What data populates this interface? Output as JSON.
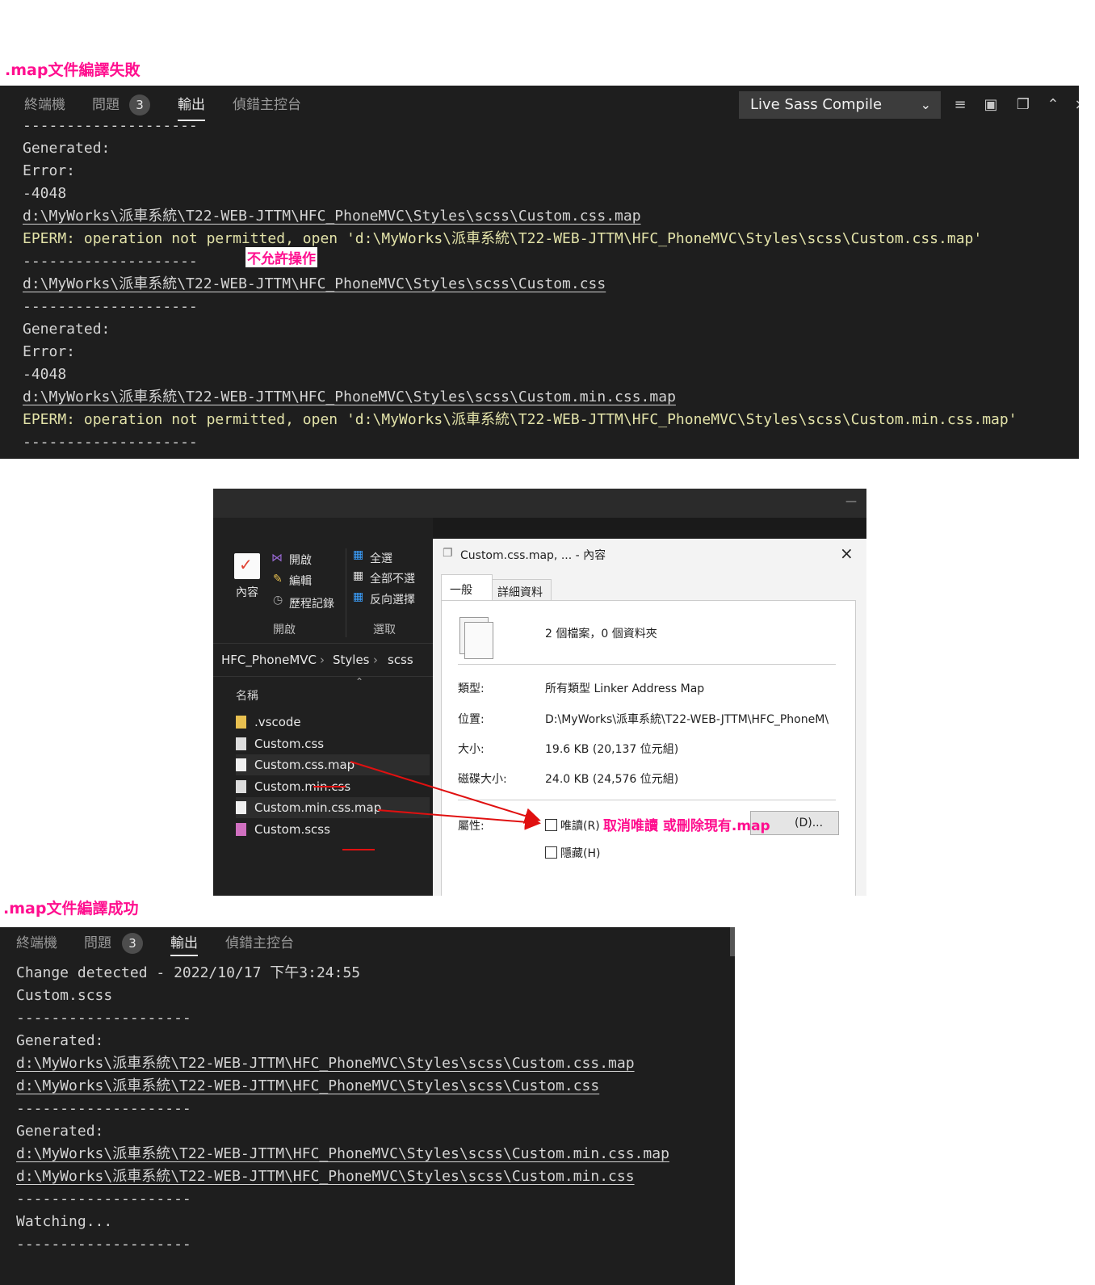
{
  "captions": {
    "fail": ".map文件編譯失敗",
    "success": ".map文件編譯成功"
  },
  "tabs": {
    "terminal": "終端機",
    "problems": "問題",
    "problems_count": "3",
    "output": "輸出",
    "debug": "偵錯主控台"
  },
  "output_channel": "Live Sass Compile",
  "fail_log": [
    {
      "t": "--------------------",
      "cls": ""
    },
    {
      "t": "Generated:",
      "cls": ""
    },
    {
      "t": "Error:",
      "cls": ""
    },
    {
      "t": "-4048",
      "cls": ""
    },
    {
      "t": "d:\\MyWorks\\派車系統\\T22-WEB-JTTM\\HFC_PhoneMVC\\Styles\\scss\\Custom.css.map",
      "cls": "u"
    },
    {
      "t": "EPERM: operation not permitted, open 'd:\\MyWorks\\派車系統\\T22-WEB-JTTM\\HFC_PhoneMVC\\Styles\\scss\\Custom.css.map'",
      "cls": "err"
    },
    {
      "t": "--------------------",
      "cls": ""
    },
    {
      "t": "d:\\MyWorks\\派車系統\\T22-WEB-JTTM\\HFC_PhoneMVC\\Styles\\scss\\Custom.css",
      "cls": "u"
    },
    {
      "t": "--------------------",
      "cls": ""
    },
    {
      "t": "Generated:",
      "cls": ""
    },
    {
      "t": "Error:",
      "cls": ""
    },
    {
      "t": "-4048",
      "cls": ""
    },
    {
      "t": "d:\\MyWorks\\派車系統\\T22-WEB-JTTM\\HFC_PhoneMVC\\Styles\\scss\\Custom.min.css.map",
      "cls": "u"
    },
    {
      "t": "EPERM: operation not permitted, open 'd:\\MyWorks\\派車系統\\T22-WEB-JTTM\\HFC_PhoneMVC\\Styles\\scss\\Custom.min.css.map'",
      "cls": "err"
    },
    {
      "t": "--------------------",
      "cls": ""
    }
  ],
  "annotation_not_permitted": "不允許操作",
  "explorer": {
    "ribbon": {
      "properties": "內容",
      "open": "開啟",
      "edit": "編輯",
      "history": "歷程記錄",
      "group_open": "開啟",
      "select_all": "全選",
      "select_none": "全部不選",
      "invert": "反向選擇",
      "group_select": "選取"
    },
    "breadcrumb": [
      "HFC_PhoneMVC",
      "Styles",
      "scss"
    ],
    "column_name": "名稱",
    "files": [
      ".vscode",
      "Custom.css",
      "Custom.css.map",
      "Custom.min.css",
      "Custom.min.css.map",
      "Custom.scss"
    ]
  },
  "dialog": {
    "title": "Custom.css.map, ... - 內容",
    "tab_general": "一般",
    "tab_details": "詳細資料",
    "summary": "2 個檔案，0 個資料夾",
    "type_label": "類型:",
    "type_value": "所有類型 Linker Address Map",
    "loc_label": "位置:",
    "loc_value": "D:\\MyWorks\\派車系統\\T22-WEB-JTTM\\HFC_PhoneM\\",
    "size_label": "大小:",
    "size_value": "19.6 KB (20,137 位元組)",
    "disk_label": "磁碟大小:",
    "disk_value": "24.0 KB (24,576 位元組)",
    "attr_label": "屬性:",
    "readonly": "唯讀(R)",
    "hidden": "隱藏(H)",
    "advanced": "(D)...",
    "annotation": "取消唯讀 或刪除現有.map"
  },
  "success_log": [
    {
      "t": "Change detected - 2022/10/17 下午3:24:55",
      "cls": ""
    },
    {
      "t": "Custom.scss",
      "cls": ""
    },
    {
      "t": "--------------------",
      "cls": ""
    },
    {
      "t": "Generated:",
      "cls": ""
    },
    {
      "t": "d:\\MyWorks\\派車系統\\T22-WEB-JTTM\\HFC_PhoneMVC\\Styles\\scss\\Custom.css.map",
      "cls": "u"
    },
    {
      "t": "d:\\MyWorks\\派車系統\\T22-WEB-JTTM\\HFC_PhoneMVC\\Styles\\scss\\Custom.css",
      "cls": "u"
    },
    {
      "t": "--------------------",
      "cls": ""
    },
    {
      "t": "Generated:",
      "cls": ""
    },
    {
      "t": "d:\\MyWorks\\派車系統\\T22-WEB-JTTM\\HFC_PhoneMVC\\Styles\\scss\\Custom.min.css.map",
      "cls": "u"
    },
    {
      "t": "d:\\MyWorks\\派車系統\\T22-WEB-JTTM\\HFC_PhoneMVC\\Styles\\scss\\Custom.min.css",
      "cls": "u"
    },
    {
      "t": "--------------------",
      "cls": ""
    },
    {
      "t": "Watching...",
      "cls": ""
    },
    {
      "t": "--------------------",
      "cls": ""
    }
  ]
}
